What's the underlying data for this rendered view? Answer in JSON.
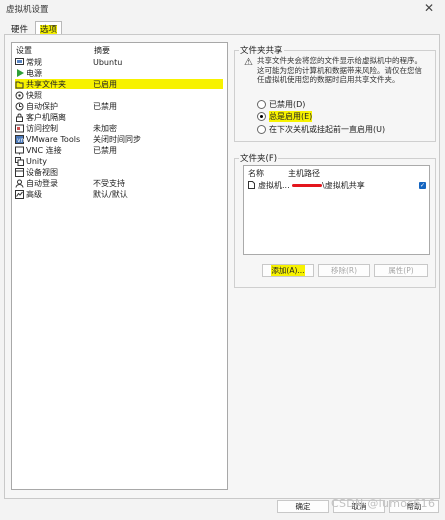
{
  "window": {
    "title": "虚拟机设置",
    "close_glyph": "✕"
  },
  "tabs": [
    {
      "label": "硬件",
      "active": false
    },
    {
      "label": "选项",
      "active": true
    }
  ],
  "settings_list": {
    "header": {
      "setting": "设置",
      "summary": "摘要"
    },
    "items": [
      {
        "name": "常规",
        "summary": "Ubuntu",
        "icon": "general-icon"
      },
      {
        "name": "电源",
        "summary": "",
        "icon": "power-play-icon"
      },
      {
        "name": "共享文件夹",
        "summary": "已启用",
        "icon": "shared-folder-icon",
        "selected": true
      },
      {
        "name": "快照",
        "summary": "",
        "icon": "snapshot-icon"
      },
      {
        "name": "自动保护",
        "summary": "已禁用",
        "icon": "autoprotect-icon"
      },
      {
        "name": "客户机隔离",
        "summary": "",
        "icon": "guest-isolation-icon"
      },
      {
        "name": "访问控制",
        "summary": "未加密",
        "icon": "access-control-icon"
      },
      {
        "name": "VMware Tools",
        "summary": "关闭时间同步",
        "icon": "vmware-tools-icon"
      },
      {
        "name": "VNC 连接",
        "summary": "已禁用",
        "icon": "vnc-icon"
      },
      {
        "name": "Unity",
        "summary": "",
        "icon": "unity-icon"
      },
      {
        "name": "设备视图",
        "summary": "",
        "icon": "device-view-icon"
      },
      {
        "name": "自动登录",
        "summary": "不受支持",
        "icon": "autologin-icon"
      },
      {
        "name": "高级",
        "summary": "默认/默认",
        "icon": "advanced-icon"
      }
    ]
  },
  "folder_sharing": {
    "legend": "文件夹共享",
    "description": "共享文件夹会将您的文件显示给虚拟机中的程序。这可能为您的计算机和数据带来风险。请仅在您信任虚拟机使用您的数据时启用共享文件夹。",
    "options": [
      {
        "label": "已禁用(D)",
        "checked": false
      },
      {
        "label": "总是启用(E)",
        "checked": true
      },
      {
        "label": "在下次关机或挂起前一直启用(U)",
        "checked": false
      }
    ]
  },
  "folders": {
    "legend": "文件夹(F)",
    "columns": {
      "name": "名称",
      "host_path": "主机路径"
    },
    "rows": [
      {
        "name": "虚拟机...",
        "host_path": "\\虚拟机共享",
        "enabled": true
      }
    ],
    "buttons": {
      "add": "添加(A)...",
      "remove": "移除(R)",
      "properties": "属性(P)"
    }
  },
  "footer": {
    "ok": "确定",
    "cancel": "取消",
    "help": "帮助"
  },
  "watermark": "CSDN @lumos616",
  "colors": {
    "highlight": "#f7f200",
    "checkbox": "#1565c0",
    "redaction": "#e3161d"
  }
}
